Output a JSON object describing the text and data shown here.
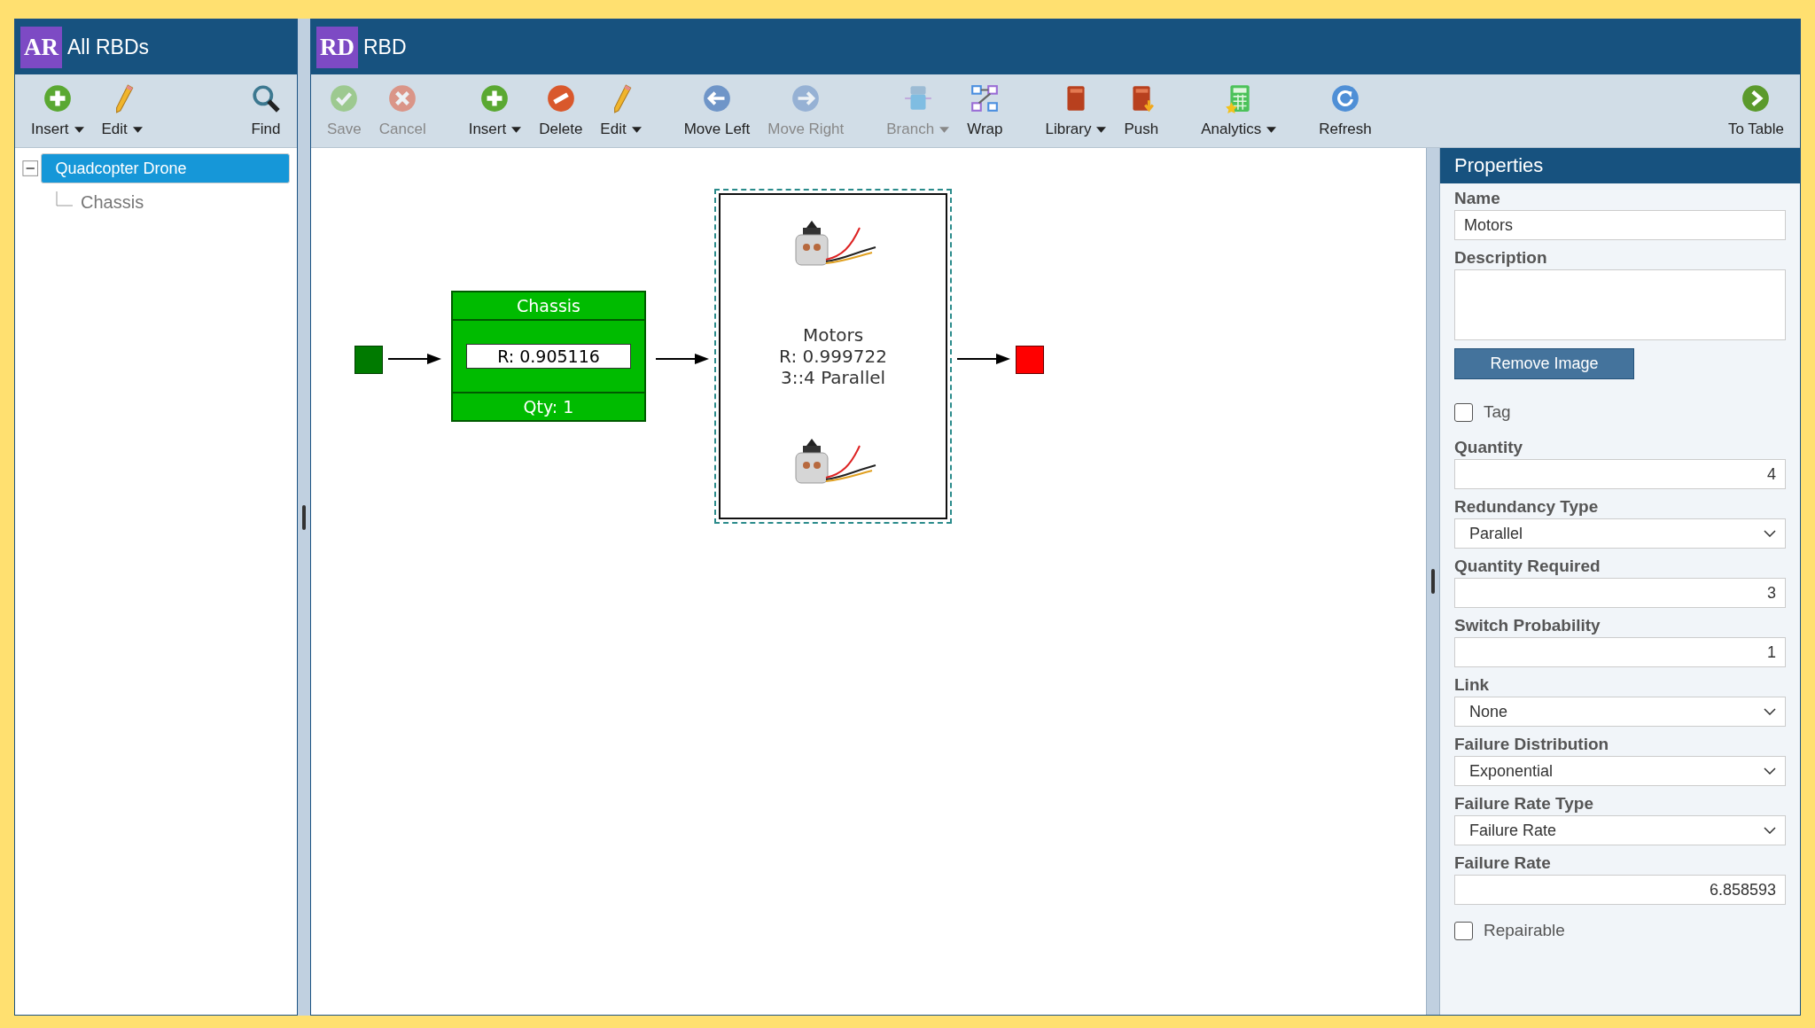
{
  "left_panel": {
    "badge": "AR",
    "title": "All RBDs",
    "toolbar": [
      {
        "kind": "add",
        "label": "Insert",
        "caret": true,
        "disabled": false
      },
      {
        "kind": "pencil",
        "label": "Edit",
        "caret": true,
        "disabled": false
      },
      {
        "kind": "search",
        "label": "Find",
        "caret": false,
        "disabled": false
      }
    ],
    "tree": [
      {
        "label": "Quadcopter Drone",
        "selected": true,
        "expanded": true,
        "children": [
          {
            "label": "Chassis",
            "selected": false
          }
        ]
      }
    ]
  },
  "main_panel": {
    "badge": "RD",
    "title": "RBD",
    "toolbar": [
      {
        "kind": "check",
        "label": "Save",
        "caret": false,
        "disabled": true
      },
      {
        "kind": "cancel",
        "label": "Cancel",
        "caret": false,
        "disabled": true
      },
      {
        "kind": "add",
        "label": "Insert",
        "caret": true,
        "disabled": false
      },
      {
        "kind": "delete",
        "label": "Delete",
        "caret": false,
        "disabled": false
      },
      {
        "kind": "pencil",
        "label": "Edit",
        "caret": true,
        "disabled": false
      },
      {
        "kind": "left",
        "label": "Move Left",
        "caret": false,
        "disabled": false
      },
      {
        "kind": "right",
        "label": "Move Right",
        "caret": false,
        "disabled": true
      },
      {
        "kind": "branch",
        "label": "Branch",
        "caret": true,
        "disabled": true
      },
      {
        "kind": "wrap",
        "label": "Wrap",
        "caret": false,
        "disabled": false
      },
      {
        "kind": "book",
        "label": "Library",
        "caret": true,
        "disabled": false
      },
      {
        "kind": "push",
        "label": "Push",
        "caret": false,
        "disabled": false
      },
      {
        "kind": "calculator",
        "label": "Analytics",
        "caret": true,
        "disabled": false
      },
      {
        "kind": "refresh",
        "label": "Refresh",
        "caret": false,
        "disabled": false
      },
      {
        "kind": "play",
        "label": "To Table",
        "caret": false,
        "disabled": false
      }
    ],
    "diagram": {
      "blocks": [
        {
          "kind": "block",
          "name": "Chassis",
          "reliability": "R: 0.905116",
          "quantity": "Qty: 1",
          "selected": false
        },
        {
          "kind": "group",
          "name": "Motors",
          "reliability": "R: 0.999722",
          "redundancy": "3::4 Parallel",
          "selected": true
        }
      ]
    }
  },
  "properties": {
    "title": "Properties",
    "fields": [
      {
        "kind": "text",
        "label": "Name",
        "value": "Motors"
      },
      {
        "kind": "textarea",
        "label": "Description"
      },
      {
        "kind": "button",
        "label": "Remove Image"
      },
      {
        "kind": "checkbox",
        "label": "Tag",
        "checked": false
      },
      {
        "kind": "number",
        "label": "Quantity",
        "value": "4"
      },
      {
        "kind": "select",
        "label": "Redundancy Type",
        "value": "Parallel"
      },
      {
        "kind": "number",
        "label": "Quantity Required",
        "value": "3"
      },
      {
        "kind": "number",
        "label": "Switch Probability",
        "value": "1"
      },
      {
        "kind": "select",
        "label": "Link",
        "value": "None"
      },
      {
        "kind": "select",
        "label": "Failure Distribution",
        "value": "Exponential"
      },
      {
        "kind": "select",
        "label": "Failure Rate Type",
        "value": "Failure Rate"
      },
      {
        "kind": "number",
        "label": "Failure Rate",
        "value": "6.858593"
      },
      {
        "kind": "checkbox",
        "label": "Repairable",
        "checked": false
      }
    ]
  }
}
